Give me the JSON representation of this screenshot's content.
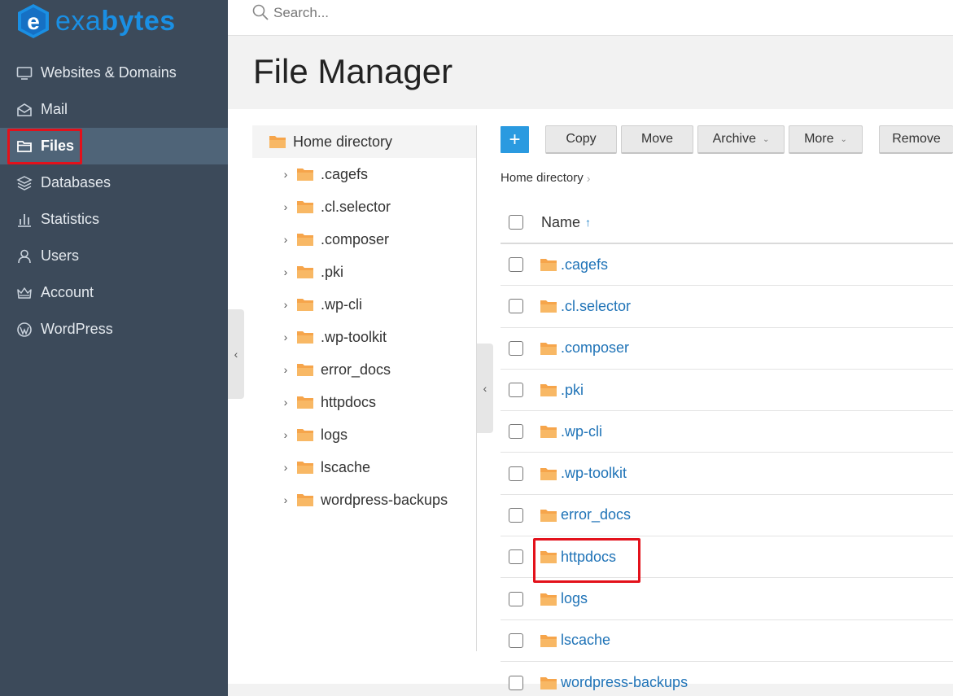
{
  "brand": {
    "name_part1": "exa",
    "name_part2": "bytes",
    "badge_letter": "e"
  },
  "search": {
    "placeholder": "Search..."
  },
  "sidebar": {
    "items": [
      {
        "label": "Websites & Domains",
        "icon": "monitor-icon",
        "active": false
      },
      {
        "label": "Mail",
        "icon": "mail-icon",
        "active": false
      },
      {
        "label": "Files",
        "icon": "folder-icon",
        "active": true
      },
      {
        "label": "Databases",
        "icon": "database-icon",
        "active": false
      },
      {
        "label": "Statistics",
        "icon": "statistics-icon",
        "active": false
      },
      {
        "label": "Users",
        "icon": "user-icon",
        "active": false
      },
      {
        "label": "Account",
        "icon": "account-icon",
        "active": false
      },
      {
        "label": "WordPress",
        "icon": "wordpress-icon",
        "active": false
      }
    ]
  },
  "page": {
    "title": "File Manager"
  },
  "tree": {
    "root": "Home directory",
    "items": [
      ".cagefs",
      ".cl.selector",
      ".composer",
      ".pki",
      ".wp-cli",
      ".wp-toolkit",
      "error_docs",
      "httpdocs",
      "logs",
      "lscache",
      "wordpress-backups"
    ]
  },
  "toolbar": {
    "add_label": "+",
    "copy_label": "Copy",
    "move_label": "Move",
    "archive_label": "Archive",
    "more_label": "More",
    "remove_label": "Remove"
  },
  "breadcrumb": {
    "current": "Home directory",
    "separator": "›"
  },
  "list": {
    "name_header": "Name",
    "sort_indicator": "↑",
    "rows": [
      ".cagefs",
      ".cl.selector",
      ".composer",
      ".pki",
      ".wp-cli",
      ".wp-toolkit",
      "error_docs",
      "httpdocs",
      "logs",
      "lscache",
      "wordpress-backups"
    ]
  },
  "colors": {
    "sidebar_bg": "#3c4a5a",
    "sidebar_active": "#4f6478",
    "accent": "#2a9ae0",
    "link": "#1f73b7",
    "folder": "#f6a54b",
    "highlight": "#e3111b"
  }
}
